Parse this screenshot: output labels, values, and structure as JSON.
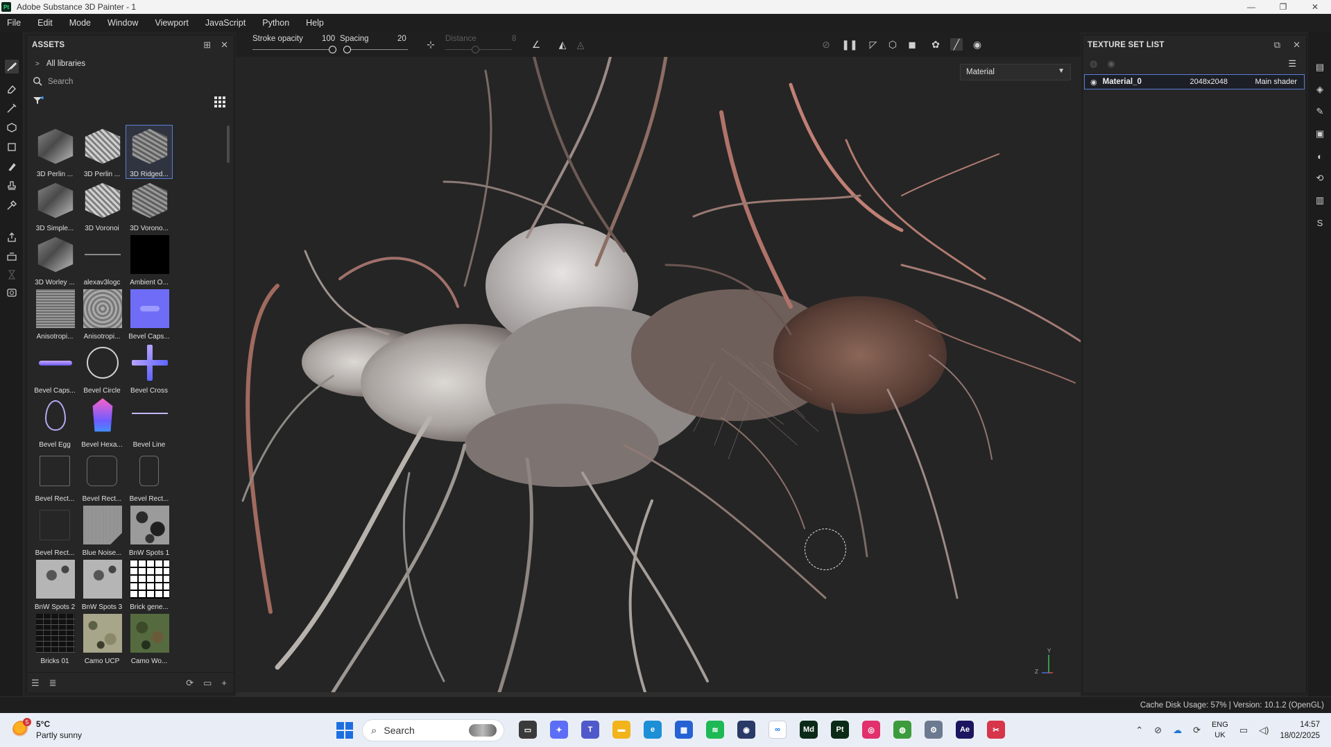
{
  "window": {
    "app_badge": "Pt",
    "title": "Adobe Substance 3D Painter - 1",
    "minimize": "—",
    "maximize": "❐",
    "close": "✕"
  },
  "menu": [
    "File",
    "Edit",
    "Mode",
    "Window",
    "Viewport",
    "JavaScript",
    "Python",
    "Help"
  ],
  "assets_panel": {
    "title": "ASSETS",
    "libraries_label": "All libraries",
    "search_placeholder": "Search",
    "items": [
      {
        "label": "3D Perlin ...",
        "kind": "cube"
      },
      {
        "label": "3D Perlin ...",
        "kind": "cube"
      },
      {
        "label": "3D Ridged...",
        "kind": "cube",
        "selected": true
      },
      {
        "label": "3D Simple...",
        "kind": "cube"
      },
      {
        "label": "3D Voronoi",
        "kind": "cube"
      },
      {
        "label": "3D Vorono...",
        "kind": "cube"
      },
      {
        "label": "3D Worley ...",
        "kind": "cube"
      },
      {
        "label": "alexav3logc",
        "kind": "line"
      },
      {
        "label": "Ambient O...",
        "kind": "black"
      },
      {
        "label": "Anisotropi...",
        "kind": "stripes"
      },
      {
        "label": "Anisotropi...",
        "kind": "swirl"
      },
      {
        "label": "Bevel Caps...",
        "kind": "bevel-caps"
      },
      {
        "label": "Bevel Caps...",
        "kind": "bevel-caps-bar"
      },
      {
        "label": "Bevel Circle",
        "kind": "bevel-circle"
      },
      {
        "label": "Bevel Cross",
        "kind": "bevel-cross"
      },
      {
        "label": "Bevel Egg",
        "kind": "bevel-egg"
      },
      {
        "label": "Bevel Hexa...",
        "kind": "bevel-hexa"
      },
      {
        "label": "Bevel Line",
        "kind": "bevel-line"
      },
      {
        "label": "Bevel Rect...",
        "kind": "rect"
      },
      {
        "label": "Bevel Rect...",
        "kind": "rect-round"
      },
      {
        "label": "Bevel Rect...",
        "kind": "rect-narrow"
      },
      {
        "label": "Bevel Rect...",
        "kind": "rect-dim"
      },
      {
        "label": "Blue Noise...",
        "kind": "blue-noise"
      },
      {
        "label": "BnW Spots 1",
        "kind": "spots"
      },
      {
        "label": "BnW Spots 2",
        "kind": "spots-b"
      },
      {
        "label": "BnW Spots 3",
        "kind": "spots-b"
      },
      {
        "label": "Brick gene...",
        "kind": "bricks-white"
      },
      {
        "label": "Bricks 01",
        "kind": "bricks-dark"
      },
      {
        "label": "Camo UCP",
        "kind": "camo"
      },
      {
        "label": "Camo Wo...",
        "kind": "camo-green"
      }
    ]
  },
  "context_bar": {
    "stroke_opacity_label": "Stroke opacity",
    "stroke_opacity_value": "100",
    "spacing_label": "Spacing",
    "spacing_value": "20",
    "distance_label": "Distance",
    "distance_value": "8"
  },
  "viewport": {
    "channel_value": "Material",
    "axis_y": "Y",
    "axis_z": "Z"
  },
  "texture_set_panel": {
    "title": "TEXTURE SET LIST",
    "rows": [
      {
        "name": "Material_0",
        "resolution": "2048x2048",
        "shader": "Main shader"
      }
    ]
  },
  "status": {
    "text": "Cache Disk Usage:    57% | Version: 10.1.2 (OpenGL)"
  },
  "taskbar": {
    "weather_badge": "5",
    "temperature": "5°C",
    "condition": "Partly sunny",
    "search_label": "Search",
    "lang_line1": "ENG",
    "lang_line2": "UK",
    "time": "14:57",
    "date": "18/02/2025",
    "apps": [
      {
        "name": "file-explorer-dark",
        "color": "#3a3a3a",
        "glyph": "▭"
      },
      {
        "name": "copilot",
        "color": "#5b6ef5",
        "glyph": "✦"
      },
      {
        "name": "teams",
        "color": "#5059c9",
        "glyph": "T"
      },
      {
        "name": "file-explorer",
        "color": "#f2b31b",
        "glyph": "▬"
      },
      {
        "name": "edge",
        "color": "#1d8fd6",
        "glyph": "e"
      },
      {
        "name": "store",
        "color": "#2563d4",
        "glyph": "▦"
      },
      {
        "name": "spotify",
        "color": "#1db954",
        "glyph": "≋"
      },
      {
        "name": "blender-like",
        "color": "#2a3a66",
        "glyph": "◉"
      },
      {
        "name": "meta",
        "color": "#ffffff",
        "glyph": "∞"
      },
      {
        "name": "substance-designer",
        "color": "#0b2b18",
        "glyph": "Md"
      },
      {
        "name": "substance-painter",
        "color": "#0b2b18",
        "glyph": "Pt"
      },
      {
        "name": "instagram",
        "color": "#e1306c",
        "glyph": "◎"
      },
      {
        "name": "chrome",
        "color": "#3c9b3c",
        "glyph": "◍"
      },
      {
        "name": "settings",
        "color": "#6b7a90",
        "glyph": "⚙"
      },
      {
        "name": "after-effects",
        "color": "#1c1660",
        "glyph": "Ae"
      },
      {
        "name": "snipping-tool",
        "color": "#d7354a",
        "glyph": "✂"
      }
    ]
  }
}
